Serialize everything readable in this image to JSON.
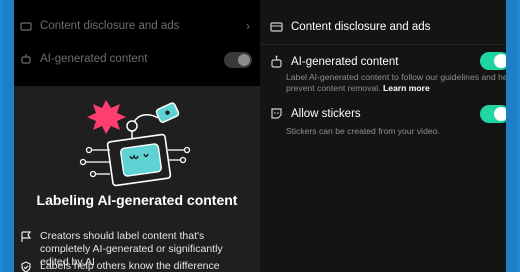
{
  "left": {
    "rows": {
      "disclosure": "Content disclosure and ads",
      "ai_generated": "AI-generated content"
    },
    "sheet": {
      "title": "Labeling AI-generated content",
      "bullets": [
        "Creators should label content that's completely AI-generated or significantly edited by AI",
        "Labels help others know the difference"
      ]
    }
  },
  "right": {
    "disclosure_title": "Content disclosure and ads",
    "ai": {
      "title": "AI-generated content",
      "desc_line1": "Label AI-generated content to follow our guidelines and help",
      "desc_line2": "prevent content removal.",
      "learn_more": "Learn more",
      "enabled": true
    },
    "stickers": {
      "title": "Allow stickers",
      "desc": "Stickers can be created from your video.",
      "enabled": true
    }
  },
  "colors": {
    "accent_toggle": "#20d5a1",
    "frame_blue": "#1d7fc6",
    "illustration_pink": "#ff3d6e",
    "illustration_teal": "#5fd3d3"
  }
}
